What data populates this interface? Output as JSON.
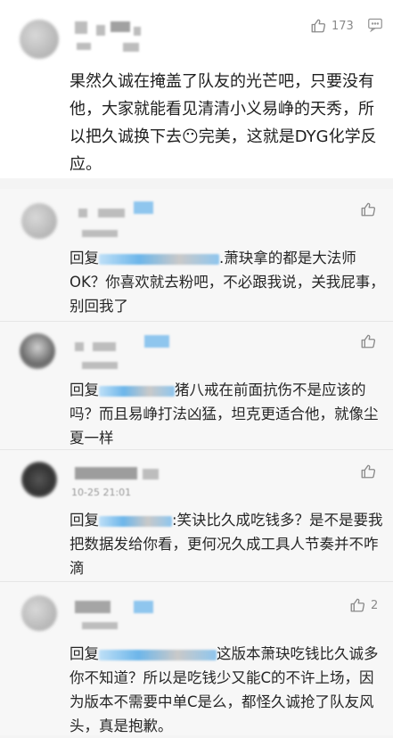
{
  "main_comment": {
    "like_count": "173",
    "text": "果然久诚在掩盖了队友的光芒吧，只要没有他，大家就能看见清清小义易峥的天秀，所以把久诚换下去😶完美，这就是DYG化学反应。"
  },
  "replies": [
    {
      "prefix": "回复",
      "text": ".萧玦拿的都是大法师OK？你喜欢就去粉吧，不必跟我说，关我屁事，别回我了",
      "like_count": ""
    },
    {
      "prefix": "回复",
      "text": "猪八戒在前面抗伤不是应该的吗？而且易峥打法凶猛，坦克更适合他，就像尘夏一样",
      "like_count": ""
    },
    {
      "prefix": "回复",
      "text": ":笑诀比久成吃钱多？是不是要我把数据发给你看，更何况久成工具人节奏并不咋滴",
      "like_count": "",
      "timestamp": "10-25 21:01"
    },
    {
      "prefix": "回复",
      "text": "这版本萧玦吃钱比久诚多你不知道？所以是吃钱少又能C的不许上场，因为版本不需要中单C是么，都怪久诚抢了队友风头，真是抱歉。",
      "like_count": "2"
    }
  ],
  "icons": [
    "thumbs-up-icon",
    "more-icon"
  ],
  "colors": {
    "background": "#f4f4f4",
    "card": "#ffffff",
    "text": "#222222",
    "muted": "#8a8a8a",
    "mask_blue": "#8fc6ee"
  }
}
